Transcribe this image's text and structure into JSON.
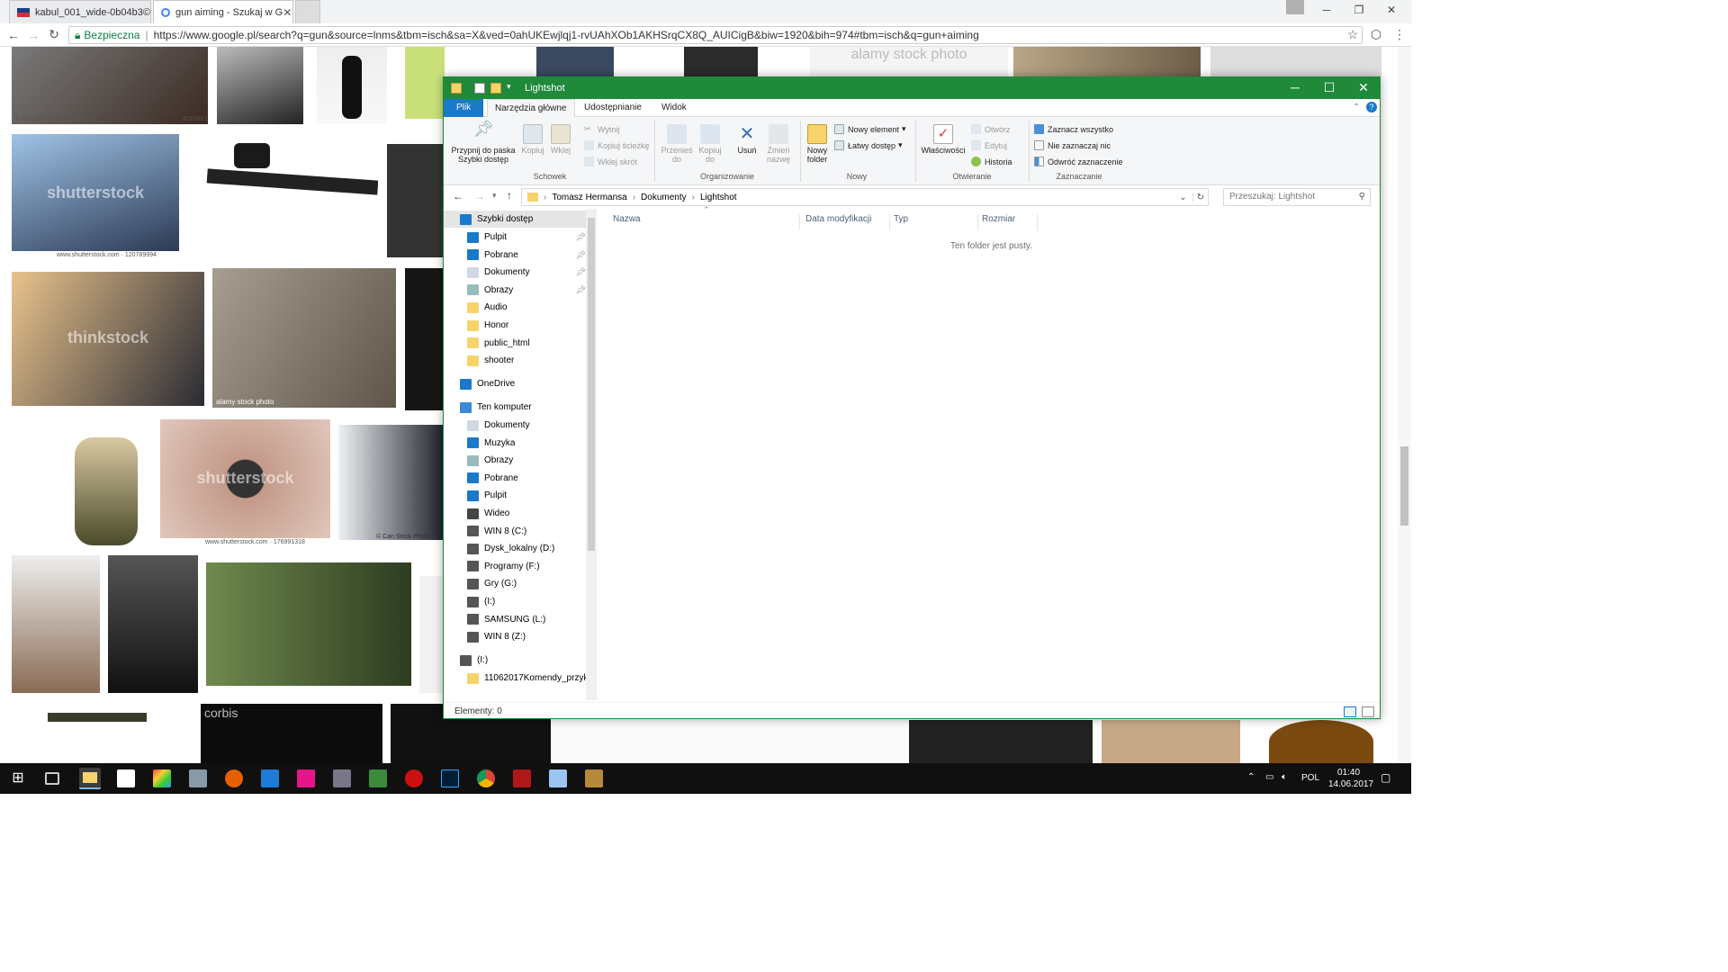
{
  "chrome": {
    "tabs": [
      {
        "title": "kabul_001_wide-0b04b3©",
        "active": false
      },
      {
        "title": "gun aiming - Szukaj w G",
        "active": true
      }
    ],
    "secure_label": "Bezpieczna",
    "url": "https://www.google.pl/search?q=gun&source=lnms&tbm=isch&sa=X&ved=0ahUKEwjlqj1-rvUAhXOb1AKHSrqCX8Q_AUICigB&biw=1920&bih=974#tbm=isch&q=gun+aiming"
  },
  "results": {
    "captions": [
      "© StockFreeImages.com",
      "4267601",
      "www.shutterstock.com · 120789994",
      "alamy stock photo",
      "www.shutterstock.com · 176991318",
      "© Can Stock Photo",
      "shutterstock",
      "thinkstock",
      "shutterstock",
      "corbis",
      "alamy stock photo"
    ]
  },
  "explorer": {
    "title": "Lightshot",
    "ribbon_tabs": {
      "file": "Plik",
      "home": "Narzędzia główne",
      "share": "Udostępnianie",
      "view": "Widok"
    },
    "ribbon": {
      "pin": "Przypnij do paska Szybki dostęp",
      "copy": "Kopiuj",
      "paste": "Wklej",
      "cut": "Wytnij",
      "copy_path": "Kopiuj ścieżkę",
      "paste_shortcut": "Wklej skrót",
      "move_to": "Przenieś do",
      "copy_to": "Kopiuj do",
      "delete": "Usuń",
      "rename": "Zmień nazwę",
      "new_folder": "Nowy folder",
      "new_item": "Nowy element",
      "easy_access": "Łatwy dostęp",
      "properties": "Właściwości",
      "open": "Otwórz",
      "edit": "Edytuj",
      "history": "Historia",
      "select_all": "Zaznacz wszystko",
      "select_none": "Nie zaznaczaj nic",
      "invert": "Odwróć zaznaczenie",
      "groups": {
        "clipboard": "Schowek",
        "organize": "Organizowanie",
        "new": "Nowy",
        "open": "Otwieranie",
        "select": "Zaznaczanie"
      }
    },
    "breadcrumb": [
      "Tomasz Hermansa",
      "Dokumenty",
      "Lightshot"
    ],
    "search_placeholder": "Przeszukaj: Lightshot",
    "nav": {
      "quick_access": "Szybki dostęp",
      "quick": [
        "Pulpit",
        "Pobrane",
        "Dokumenty",
        "Obrazy",
        "Audio",
        "Honor",
        "public_html",
        "shooter"
      ],
      "onedrive": "OneDrive",
      "this_pc": "Ten komputer",
      "pc": [
        "Dokumenty",
        "Muzyka",
        "Obrazy",
        "Pobrane",
        "Pulpit",
        "Wideo",
        "WIN 8 (C:)",
        "Dysk_lokalny (D:)",
        "Programy (F:)",
        "Gry (G:)",
        "(I:)",
        "SAMSUNG (L:)",
        "WIN 8 (Z:)"
      ],
      "drive_i": "(I:)",
      "folder_i": "11062017Komendy_przykła"
    },
    "columns": [
      "Nazwa",
      "Data modyfikacji",
      "Typ",
      "Rozmiar"
    ],
    "empty_text": "Ten folder jest pusty.",
    "status": "Elementy: 0"
  },
  "taskbar": {
    "lang": "POL",
    "time": "01:40",
    "date": "14.06.2017"
  }
}
